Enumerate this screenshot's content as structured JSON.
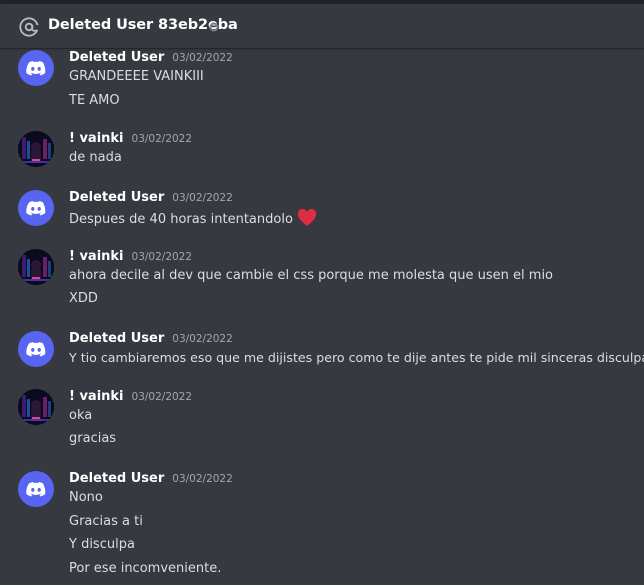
{
  "header": {
    "title": "Deleted User 83eb2eba",
    "icon": "at-icon",
    "status_icon": "offline-status-icon"
  },
  "colors": {
    "background": "#36393f",
    "discord_blurple": "#5865f2",
    "heart": "#dd2e44"
  },
  "messages": [
    {
      "author": "Deleted User",
      "avatar": "discord-logo-icon",
      "timestamp": "03/02/2022",
      "lines": [
        "GRANDEEEE VAINKIII",
        "TE AMO"
      ]
    },
    {
      "author": "! vainki",
      "avatar": "user-avatar",
      "timestamp": "03/02/2022",
      "lines": [
        "de nada"
      ]
    },
    {
      "author": "Deleted User",
      "avatar": "discord-logo-icon",
      "timestamp": "03/02/2022",
      "lines": [
        "Despues de 40 horas intentandolo"
      ],
      "emoji": "heart-emoji-icon"
    },
    {
      "author": "! vainki",
      "avatar": "user-avatar",
      "timestamp": "03/02/2022",
      "lines": [
        "ahora decile al dev que cambie el css porque me molesta que usen el mio",
        "XDD"
      ]
    },
    {
      "author": "Deleted User",
      "avatar": "discord-logo-icon",
      "timestamp": "03/02/2022",
      "lines": [
        "Y tio cambiaremos eso que me dijistes pero como te dije antes te pide mil sinceras disculpas."
      ]
    },
    {
      "author": "! vainki",
      "avatar": "user-avatar",
      "timestamp": "03/02/2022",
      "lines": [
        "oka",
        "gracias"
      ]
    },
    {
      "author": "Deleted User",
      "avatar": "discord-logo-icon",
      "timestamp": "03/02/2022",
      "lines": [
        "Nono",
        "Gracias a ti",
        "Y disculpa",
        "Por ese incomveniente."
      ]
    }
  ]
}
